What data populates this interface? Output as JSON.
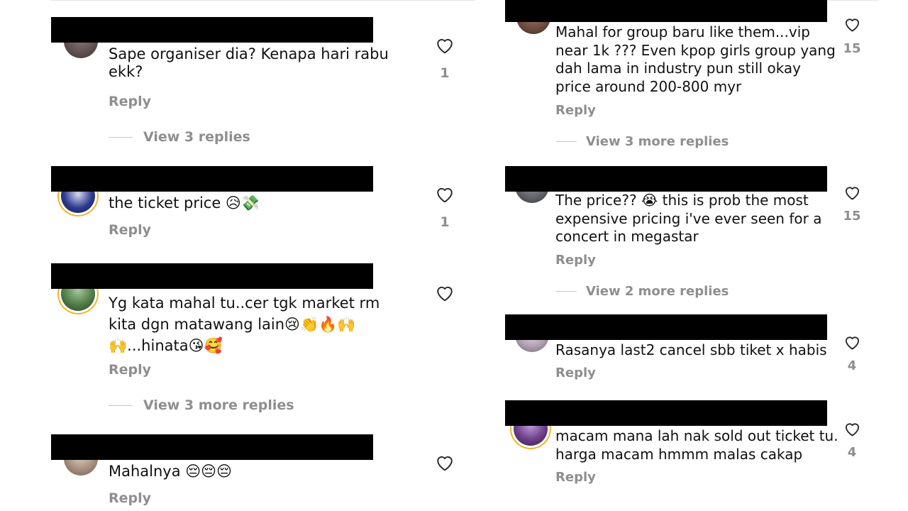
{
  "left_comments": [
    {
      "text": "Sape organiser dia? Kenapa hari rabu\nekk?",
      "likes": "1",
      "reply": "Reply",
      "view_replies": "View 3 replies"
    },
    {
      "text": "the ticket price 😥💸",
      "likes": "1",
      "reply": "Reply"
    },
    {
      "text": "Yg kata mahal tu..cer tgk market rm\nkita dgn matawang lain😢👏🔥🙌\n🙌...hinata😘🥰",
      "reply": "Reply",
      "view_replies": "View 3 more replies"
    },
    {
      "text": "Mahalnya 😔😔😔",
      "reply": "Reply"
    }
  ],
  "right_comments": [
    {
      "text": "Mahal for group baru like them...vip\nnear 1k ??? Even kpop girls group yang\ndah lama in industry pun still okay\nprice around 200-800 myr",
      "likes": "15",
      "reply": "Reply",
      "view_replies": "View 3 more replies"
    },
    {
      "text": "The price?? 😭 this is prob the most\nexpensive pricing i've ever seen for a\nconcert in megastar",
      "likes": "15",
      "reply": "Reply",
      "view_replies": "View 2 more replies"
    },
    {
      "text": "Rasanya last2 cancel sbb tiket x habis",
      "likes": "4",
      "reply": "Reply"
    },
    {
      "text": "macam mana lah nak sold out ticket tu.\nharga macam hmmm malas cakap",
      "likes": "4",
      "reply": "Reply"
    }
  ],
  "icons": {
    "like": "heart-outline-icon"
  },
  "colors": {
    "muted": "#8e8e8e",
    "redaction": "#000000",
    "story_ring": "#f0b429"
  }
}
